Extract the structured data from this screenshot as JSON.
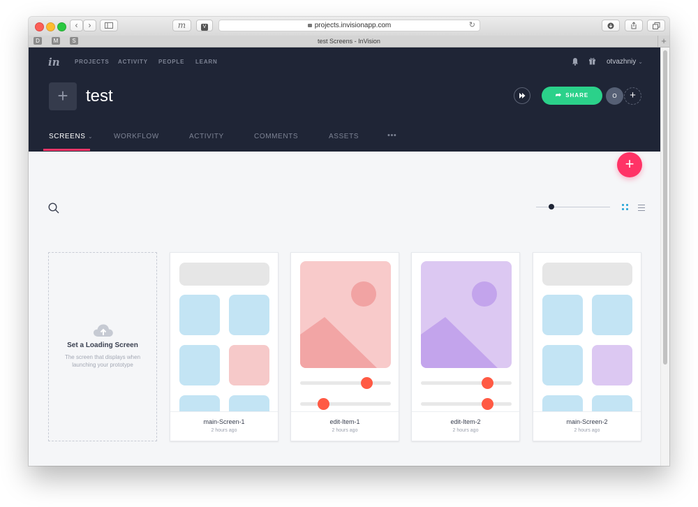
{
  "browser": {
    "url": "projects.invisionapp.com",
    "tab_title": "test Screens - InVision",
    "bookmarks": [
      "D",
      "M",
      "S"
    ],
    "toolbar_icons": [
      "back-icon",
      "forward-icon",
      "sidebar-icon",
      "notes-icon",
      "v-icon",
      "reload-icon",
      "download-icon",
      "share-icon",
      "tabs-icon"
    ]
  },
  "nav": {
    "logo": "in",
    "items": [
      "PROJECTS",
      "ACTIVITY",
      "PEOPLE",
      "LEARN"
    ],
    "username": "otvazhniy",
    "caret": "⌄"
  },
  "project": {
    "title": "test",
    "share_label": "SHARE",
    "member_initial": "O",
    "add_symbol": "+"
  },
  "tabs": [
    {
      "label": "SCREENS",
      "active": true
    },
    {
      "label": "WORKFLOW",
      "active": false
    },
    {
      "label": "ACTIVITY",
      "active": false
    },
    {
      "label": "COMMENTS",
      "active": false
    },
    {
      "label": "ASSETS",
      "active": false
    },
    {
      "label": "•••",
      "active": false
    }
  ],
  "screens_caret": "⌄",
  "fab_symbol": "+",
  "loading_screen": {
    "title": "Set a Loading Screen",
    "description": "The screen that displays when launching your prototype"
  },
  "screens": [
    {
      "name": "main-Screen-1",
      "time": "2 hours ago",
      "thumb": "grid",
      "accent": "#f6c9c9"
    },
    {
      "name": "edit-Item-1",
      "time": "2 hours ago",
      "thumb": "image",
      "accent": "#f6c9c9"
    },
    {
      "name": "edit-Item-2",
      "time": "2 hours ago",
      "thumb": "image",
      "accent": "#dcc8f2"
    },
    {
      "name": "main-Screen-2",
      "time": "2 hours ago",
      "thumb": "grid",
      "accent": "#dcc8f2"
    }
  ],
  "colors": {
    "header": "#1f2536",
    "accent_pink": "#ff3366",
    "share_green": "#2bd18a",
    "grid_blue": "#c3e4f4",
    "slider_red": "#ff5a44"
  }
}
